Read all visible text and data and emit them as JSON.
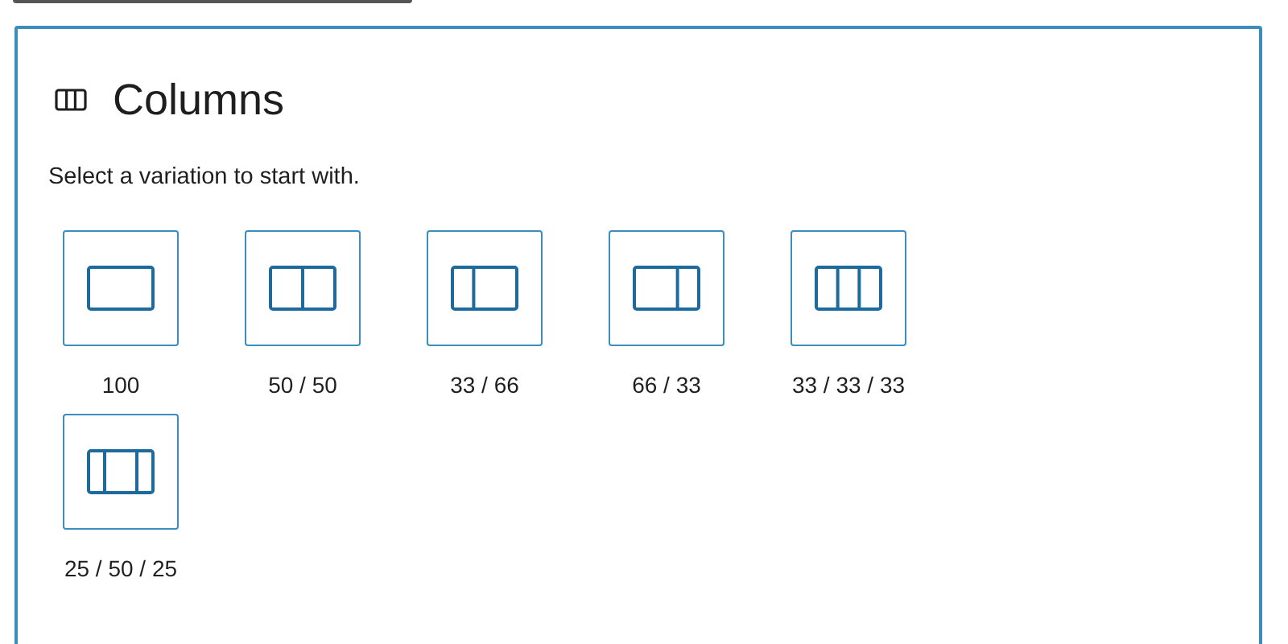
{
  "title": "Columns",
  "instructions": "Select a variation to start with.",
  "variations": [
    {
      "label": "100",
      "kind": "full"
    },
    {
      "label": "50 / 50",
      "kind": "halves"
    },
    {
      "label": "33 / 66",
      "kind": "narrow-left"
    },
    {
      "label": "66 / 33",
      "kind": "narrow-right"
    },
    {
      "label": "33 / 33 / 33",
      "kind": "thirds"
    },
    {
      "label": "25 / 50 / 25",
      "kind": "wide-center"
    }
  ]
}
